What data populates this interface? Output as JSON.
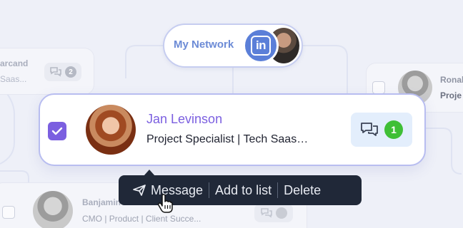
{
  "hub": {
    "label": "My Network",
    "badge_text": "in"
  },
  "main_card": {
    "checked": true,
    "name": "Jan Levinson",
    "title": "Project Specialist | Tech Saas…",
    "message_count": "1"
  },
  "ghost_cards": {
    "left_top": {
      "name": "arcand",
      "subtitle": "Saas...",
      "message_count": "2"
    },
    "right_top": {
      "name": "Ronal",
      "subtitle": "Proje"
    },
    "bottom_left": {
      "name": "Banjamin",
      "subtitle": "CMO | Product | Client Succe..."
    }
  },
  "action_bar": {
    "items": [
      {
        "label": "Message",
        "icon": "send-icon"
      },
      {
        "label": "Add to list"
      },
      {
        "label": "Delete"
      }
    ]
  },
  "colors": {
    "accent_purple": "#7b5fe0",
    "linkedin_blue": "#5b7fd8",
    "badge_green": "#3fbf36",
    "tooltip_bg": "#202838"
  }
}
